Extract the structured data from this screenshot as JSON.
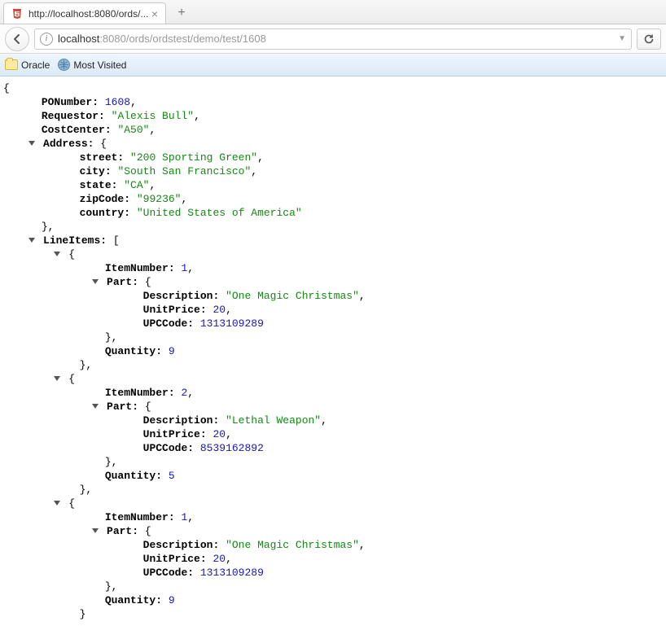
{
  "tab": {
    "title": "http://localhost:8080/ords/..."
  },
  "url": {
    "host": "localhost",
    "rest": ":8080/ords/ordstest/demo/test/1608"
  },
  "bookmarks": {
    "oracle": "Oracle",
    "mostvisited": "Most Visited"
  },
  "json": {
    "PONumber": 1608,
    "Requestor": "Alexis Bull",
    "CostCenter": "A50",
    "Address": {
      "street": "200 Sporting Green",
      "city": "South San Francisco",
      "state": "CA",
      "zipCode": "99236",
      "country": "United States of America"
    },
    "LineItems": [
      {
        "ItemNumber": 1,
        "Part": {
          "Description": "One Magic Christmas",
          "UnitPrice": 20,
          "UPCCode": 1313109289
        },
        "Quantity": 9
      },
      {
        "ItemNumber": 2,
        "Part": {
          "Description": "Lethal Weapon",
          "UnitPrice": 20,
          "UPCCode": 8539162892
        },
        "Quantity": 5
      },
      {
        "ItemNumber": 1,
        "Part": {
          "Description": "One Magic Christmas",
          "UnitPrice": 20,
          "UPCCode": 1313109289
        },
        "Quantity": 9
      }
    ]
  }
}
